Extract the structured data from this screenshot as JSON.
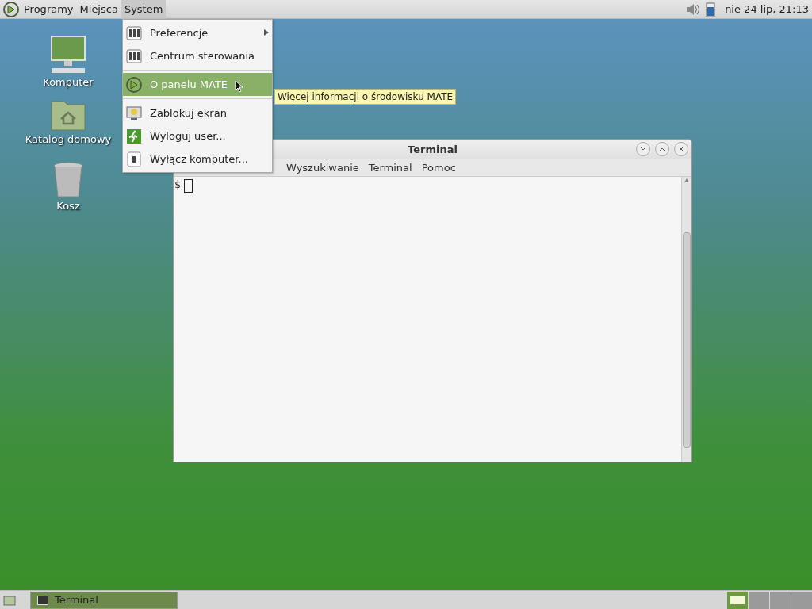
{
  "top_panel": {
    "menus": [
      {
        "label": "Programy",
        "selected": false
      },
      {
        "label": "Miejsca",
        "selected": false
      },
      {
        "label": "System",
        "selected": true
      }
    ],
    "clock": "nie 24 lip, 21:13"
  },
  "desktop_icons": [
    {
      "label": "Komputer",
      "kind": "computer"
    },
    {
      "label": "Katalog domowy",
      "kind": "home"
    },
    {
      "label": "Kosz",
      "kind": "trash"
    }
  ],
  "terminal": {
    "title": "Terminal",
    "menus": [
      "Wyszukiwanie",
      "Terminal",
      "Pomoc"
    ],
    "prompt": "$"
  },
  "system_menu": {
    "items": [
      {
        "kind": "prefs",
        "label": "Preferencje",
        "submenu": true,
        "selected": false
      },
      {
        "kind": "control",
        "label": "Centrum sterowania",
        "submenu": false,
        "selected": false
      },
      {
        "kind": "separator"
      },
      {
        "kind": "mate",
        "label": "O panelu MATE",
        "submenu": false,
        "selected": true
      },
      {
        "kind": "separator"
      },
      {
        "kind": "lock",
        "label": "Zablokuj ekran",
        "submenu": false,
        "selected": false
      },
      {
        "kind": "logout",
        "label": "Wyloguj user...",
        "submenu": false,
        "selected": false
      },
      {
        "kind": "shutdown",
        "label": "Wyłącz komputer...",
        "submenu": false,
        "selected": false
      }
    ]
  },
  "tooltip": "Więcej informacji o środowisku MATE",
  "bottom_panel": {
    "tasks": [
      {
        "label": "Terminal",
        "selected": true
      }
    ],
    "workspaces": [
      {
        "selected": true
      },
      {
        "selected": false
      },
      {
        "selected": false
      },
      {
        "selected": false
      }
    ]
  }
}
